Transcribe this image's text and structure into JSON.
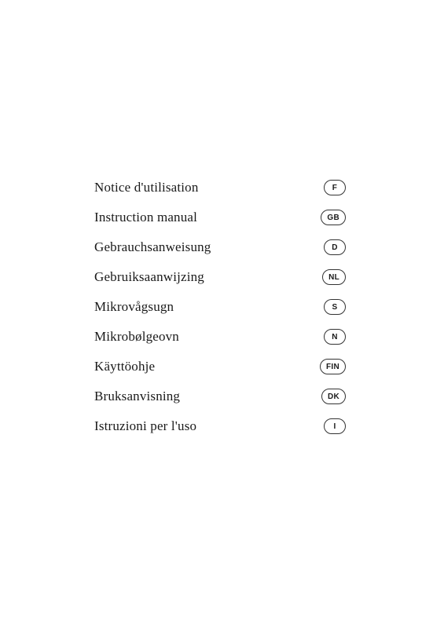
{
  "items": [
    {
      "id": "notice-utilisation",
      "label": "Notice d'utilisation",
      "badge": "F"
    },
    {
      "id": "instruction-manual",
      "label": "Instruction manual",
      "badge": "GB"
    },
    {
      "id": "gebrauchsanweisung",
      "label": "Gebrauchsanweisung",
      "badge": "D"
    },
    {
      "id": "gebruiksaanwijzing",
      "label": "Gebruiksaanwijzing",
      "badge": "NL"
    },
    {
      "id": "mikrovagsugn",
      "label": "Mikrovågsugn",
      "badge": "S"
    },
    {
      "id": "mikrobolgeovn",
      "label": "Mikrobølgeovn",
      "badge": "N"
    },
    {
      "id": "kayttoohjе",
      "label": "Käyttöohje",
      "badge": "FIN"
    },
    {
      "id": "bruksanvisning",
      "label": "Bruksanvisning",
      "badge": "DK"
    },
    {
      "id": "istruzioni-per-luso",
      "label": "Istruzioni per l'uso",
      "badge": "I"
    }
  ]
}
